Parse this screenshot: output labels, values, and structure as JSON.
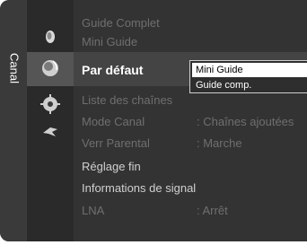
{
  "category": {
    "label": "Canal"
  },
  "icons": [
    {
      "name": "picture-icon"
    },
    {
      "name": "channel-icon"
    },
    {
      "name": "setup-icon"
    },
    {
      "name": "input-icon"
    }
  ],
  "menu": {
    "items": [
      {
        "label": "Guide Complet",
        "value": ""
      },
      {
        "label": "Mini Guide",
        "value": ""
      },
      {
        "label": "Par défaut",
        "value": ""
      },
      {
        "label": "Liste des chaînes",
        "value": ""
      },
      {
        "label": "Mode Canal",
        "value": ": Chaînes ajoutées"
      },
      {
        "label": "Verr Parental",
        "value": ": Marche"
      },
      {
        "label": "Réglage fin",
        "value": ""
      },
      {
        "label": "Informations de signal",
        "value": ""
      },
      {
        "label": "LNA",
        "value": ": Arrêt"
      }
    ]
  },
  "dropdown": {
    "options": [
      "Mini Guide",
      "Guide comp."
    ],
    "selected": "Mini Guide"
  },
  "colors": {
    "background": "#333333",
    "highlight": "#444444",
    "dropdown_border": "#cfcfcf"
  }
}
